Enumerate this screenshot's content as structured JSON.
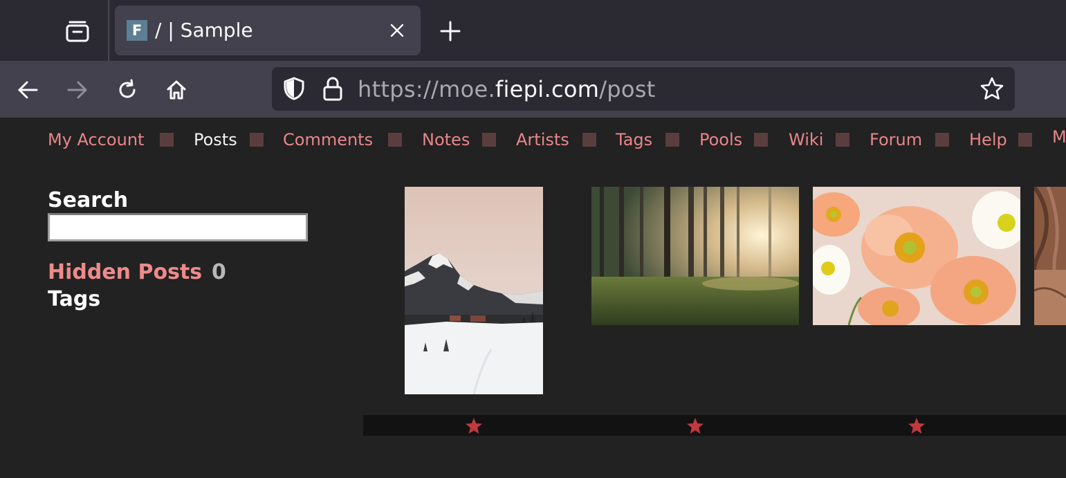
{
  "browser": {
    "tab_title": "/ | Sample",
    "tab_favicon_letter": "F",
    "url_scheme": "https://",
    "url_subdomain": "moe.",
    "url_domain": "fiepi.com",
    "url_path": "/post"
  },
  "site_nav": {
    "items": [
      {
        "label": "My Account"
      },
      {
        "label": "Posts"
      },
      {
        "label": "Comments"
      },
      {
        "label": "Notes"
      },
      {
        "label": "Artists"
      },
      {
        "label": "Tags"
      },
      {
        "label": "Pools"
      },
      {
        "label": "Wiki"
      },
      {
        "label": "Forum"
      },
      {
        "label": "Help"
      },
      {
        "label": "M"
      }
    ],
    "active_index": 1,
    "link_color": "#e9868a",
    "active_color": "#f2f2f2"
  },
  "sidebar": {
    "search_heading": "Search",
    "search_value": "",
    "hidden_posts_label": "Hidden Posts",
    "hidden_posts_count": "0",
    "tags_heading": "Tags"
  },
  "posts": [
    {
      "subject": "snowy mountain village"
    },
    {
      "subject": "sunlit forest"
    },
    {
      "subject": "peach poppy flowers"
    },
    {
      "subject": "tree bark (cropped)"
    }
  ],
  "colors": {
    "page_bg": "#222222",
    "star": "#c0393f",
    "hidden_posts": "#f08a8a"
  }
}
